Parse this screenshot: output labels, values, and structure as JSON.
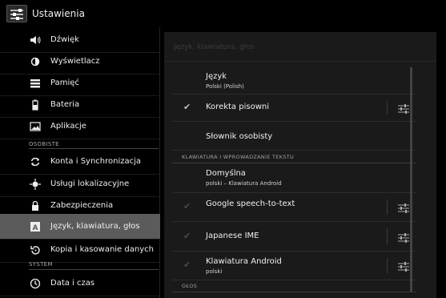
{
  "actionbar": {
    "title": "Ustawienia",
    "icon": "settings-sliders-icon"
  },
  "left": {
    "items_top": [
      {
        "label": "Dźwięk",
        "icon": "speaker-icon"
      },
      {
        "label": "Wyświetlacz",
        "icon": "brightness-icon"
      },
      {
        "label": "Pamięć",
        "icon": "storage-icon"
      },
      {
        "label": "Bateria",
        "icon": "battery-icon"
      },
      {
        "label": "Aplikacje",
        "icon": "apps-icon"
      }
    ],
    "section_personal": "OSOBISTE",
    "items_personal": [
      {
        "label": "Konta i Synchronizacja",
        "icon": "sync-icon"
      },
      {
        "label": "Usługi lokalizacyjne",
        "icon": "location-icon"
      },
      {
        "label": "Zabezpieczenia",
        "icon": "lock-icon"
      },
      {
        "label": "Język, klawiatura, głos",
        "icon": "keyboard-a-icon"
      },
      {
        "label": "Kopia i kasowanie danych",
        "icon": "backup-icon"
      }
    ],
    "section_system": "SYSTEM",
    "items_system": [
      {
        "label": "Data i czas",
        "icon": "clock-icon"
      }
    ]
  },
  "right": {
    "header": "Język, klawiatura, głos",
    "lang": {
      "title": "Język",
      "summary": "Polski (Polish)"
    },
    "spell": {
      "title": "Korekta pisowni"
    },
    "dict": {
      "title": "Słownik osobisty"
    },
    "cat_keyboard": "KLAWIATURA I WPROWADZANIE TEKSTU",
    "default_kb": {
      "title": "Domyślna",
      "summary": "polski – Klawiatura Android"
    },
    "google_stt": {
      "title": "Google speech-to-text"
    },
    "japanese_ime": {
      "title": "Japanese IME"
    },
    "android_kb": {
      "title": "Klawiatura Android",
      "summary": "polski"
    },
    "cat_voice": "GŁOS"
  }
}
